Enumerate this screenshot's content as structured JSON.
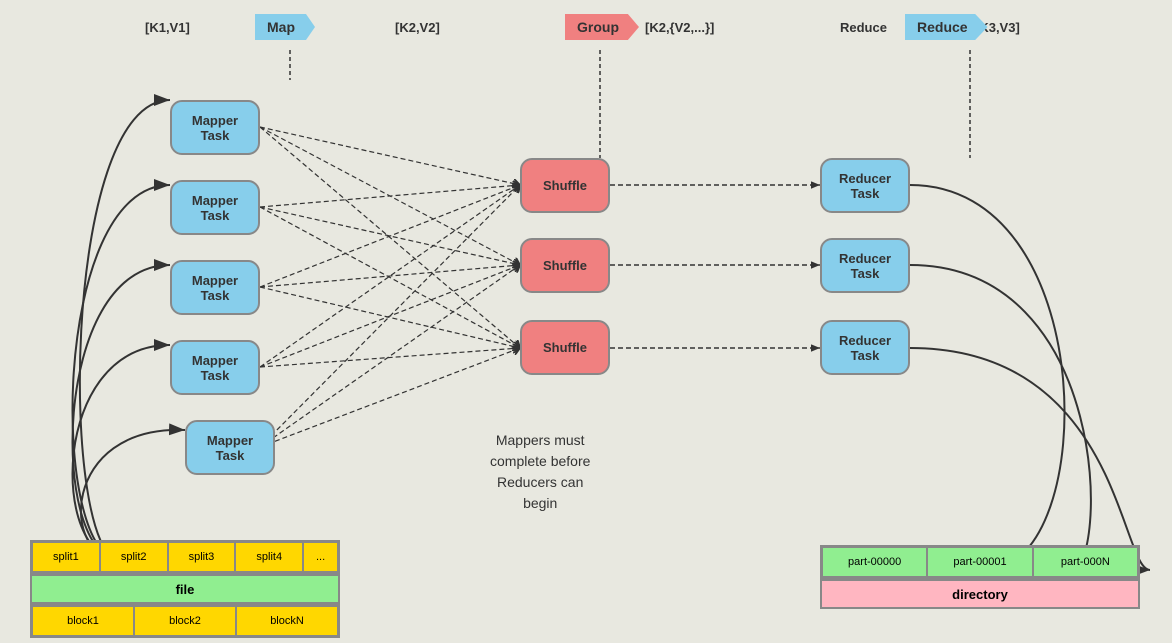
{
  "header": {
    "k1v1_label": "[K1,V1]",
    "k2v2_label": "[K2,V2]",
    "k2v2set_label": "[K2,{V2,...}]",
    "k3v3_label": "[K3,V3]",
    "map_label": "Map",
    "group_label": "Group",
    "reduce_label": "Reduce"
  },
  "mapper_tasks": [
    {
      "label": "Mapper\nTask"
    },
    {
      "label": "Mapper\nTask"
    },
    {
      "label": "Mapper\nTask"
    },
    {
      "label": "Mapper\nTask"
    },
    {
      "label": "Mapper\nTask"
    }
  ],
  "shuffle_tasks": [
    {
      "label": "Shuffle"
    },
    {
      "label": "Shuffle"
    },
    {
      "label": "Shuffle"
    }
  ],
  "reducer_tasks": [
    {
      "label": "Reducer\nTask"
    },
    {
      "label": "Reducer\nTask"
    },
    {
      "label": "Reducer\nTask"
    }
  ],
  "bottom_left": {
    "splits": [
      "split1",
      "split2",
      "split3",
      "split4",
      "..."
    ],
    "file_label": "file",
    "blocks": [
      "block1",
      "block2",
      "blockN"
    ]
  },
  "bottom_right": {
    "parts": [
      "part-00000",
      "part-00001",
      "part-000N"
    ],
    "dir_label": "directory"
  },
  "note": "Mappers must\ncomplete before\nReducers can\nbegin"
}
